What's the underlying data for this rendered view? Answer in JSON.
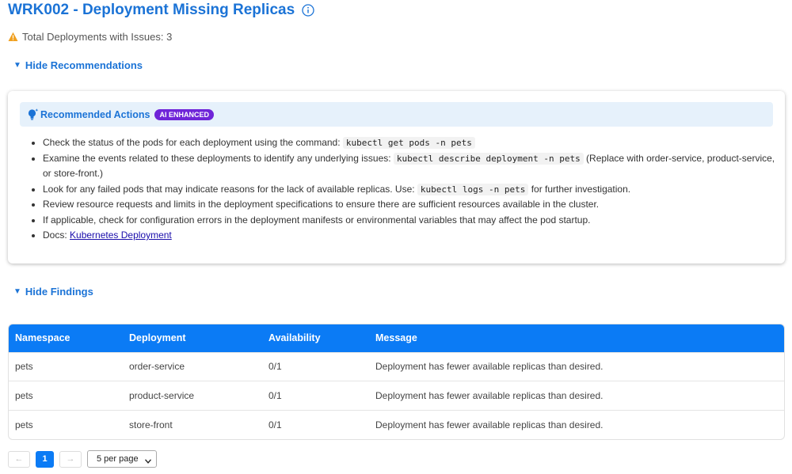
{
  "header": {
    "title": "WRK002 - Deployment Missing Replicas",
    "info_icon": "info-icon",
    "issues_label": "Total Deployments with Issues: 3",
    "warning_icon": "warning-icon"
  },
  "recommendations": {
    "toggle_label": "Hide Recommendations",
    "title": "Recommended Actions",
    "badge": "AI ENHANCED",
    "icon": "lightbulb-icon",
    "items": [
      {
        "text": "Check the status of the pods for each deployment using the command: ",
        "code": "kubectl get pods -n pets",
        "suffix": ""
      },
      {
        "text": "Examine the events related to these deployments to identify any underlying issues: ",
        "code": "kubectl describe deployment -n pets",
        "suffix": " (Replace with order-service, product-service, or store-front.)"
      },
      {
        "text": "Look for any failed pods that may indicate reasons for the lack of available replicas. Use: ",
        "code": "kubectl logs -n pets",
        "suffix": " for further investigation."
      },
      {
        "text": "Review resource requests and limits in the deployment specifications to ensure there are sufficient resources available in the cluster.",
        "code": "",
        "suffix": ""
      },
      {
        "text": "If applicable, check for configuration errors in the deployment manifests or environmental variables that may affect the pod startup.",
        "code": "",
        "suffix": ""
      }
    ],
    "docs_label": "Docs: ",
    "docs_link": "Kubernetes Deployment"
  },
  "findings": {
    "toggle_label": "Hide Findings",
    "columns": [
      "Namespace",
      "Deployment",
      "Availability",
      "Message"
    ],
    "rows": [
      [
        "pets",
        "order-service",
        "0/1",
        "Deployment has fewer available replicas than desired."
      ],
      [
        "pets",
        "product-service",
        "0/1",
        "Deployment has fewer available replicas than desired."
      ],
      [
        "pets",
        "store-front",
        "0/1",
        "Deployment has fewer available replicas than desired."
      ]
    ]
  },
  "pagination": {
    "prev": "←",
    "current_page": "1",
    "next": "→",
    "per_page": "5 per page"
  },
  "colors": {
    "accent": "#1b73d6",
    "table_header": "#0b7bf5",
    "badge": "#6f24d8",
    "warning": "#f0a020"
  }
}
